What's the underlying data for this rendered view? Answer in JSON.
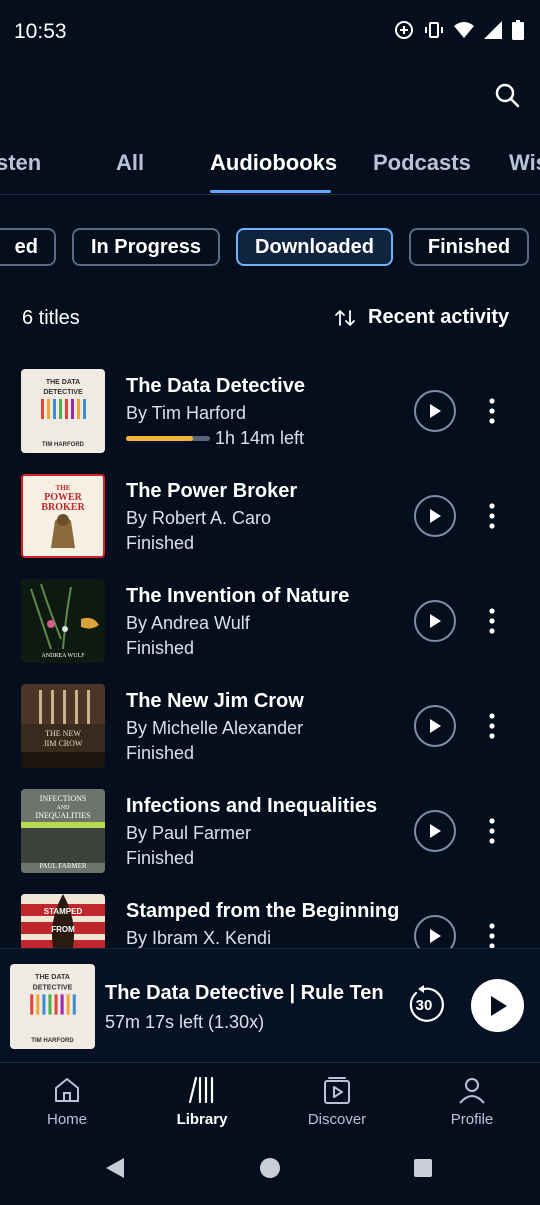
{
  "status_bar": {
    "time": "10:53"
  },
  "tabs": [
    {
      "label": "sten",
      "active": false
    },
    {
      "label": "All",
      "active": false
    },
    {
      "label": "Audiobooks",
      "active": true
    },
    {
      "label": "Podcasts",
      "active": false
    },
    {
      "label": "Wis",
      "active": false
    }
  ],
  "filters": [
    {
      "label": "ed",
      "active": false
    },
    {
      "label": "In Progress",
      "active": false
    },
    {
      "label": "Downloaded",
      "active": true
    },
    {
      "label": "Finished",
      "active": false
    }
  ],
  "library": {
    "count": "6 titles",
    "sort_label": "Recent activity"
  },
  "books": [
    {
      "title": "The Data Detective",
      "author": "By Tim Harford",
      "status": "1h 14m left",
      "progress": 0.8
    },
    {
      "title": "The Power Broker",
      "author": "By Robert A. Caro",
      "status": "Finished"
    },
    {
      "title": "The Invention of Nature",
      "author": "By Andrea Wulf",
      "status": "Finished"
    },
    {
      "title": "The New Jim Crow",
      "author": "By Michelle Alexander",
      "status": "Finished"
    },
    {
      "title": "Infections and Inequalities",
      "author": "By Paul Farmer",
      "status": "Finished"
    },
    {
      "title": "Stamped from the Beginning",
      "author": "By Ibram X. Kendi",
      "status": ""
    }
  ],
  "covers": {
    "data_detective": {
      "title_line1": "THE DATA",
      "title_line2": "DETECTIVE",
      "author": "TIM HARFORD"
    },
    "power_broker": {
      "line1": "THE",
      "line2": "POWER",
      "line3": "BROKER"
    },
    "invention": {
      "author": "ANDREA WULF"
    },
    "jim_crow": {
      "line1": "THE NEW",
      "line2": "JIM CROW"
    },
    "infections": {
      "line1": "INFECTIONS",
      "line2": "AND",
      "line3": "INEQUALITIES",
      "author": "PAUL FARMER"
    },
    "stamped": {
      "line1": "STAMPED",
      "line2": "FROM"
    }
  },
  "mini_player": {
    "title": "The Data Detective | Rule Ten:",
    "subtitle": "57m 17s left (1.30x)",
    "skip_back": "30"
  },
  "bottom_nav": [
    {
      "label": "Home",
      "icon": "home-icon"
    },
    {
      "label": "Library",
      "icon": "library-icon",
      "active": true
    },
    {
      "label": "Discover",
      "icon": "discover-icon"
    },
    {
      "label": "Profile",
      "icon": "profile-icon"
    }
  ],
  "colors": {
    "background": "#040e1c",
    "accent": "#5ca8ff",
    "progress": "#f3b43b"
  }
}
